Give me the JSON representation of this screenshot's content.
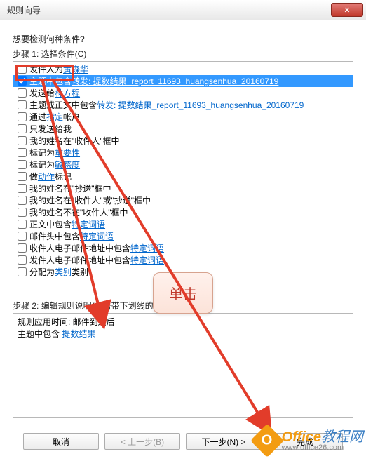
{
  "window": {
    "title": "规则向导"
  },
  "heading": "想要检测何种条件?",
  "step1_label": "步骤 1: 选择条件(C)",
  "conditions": [
    {
      "checked": false,
      "prefix": "发件人为 ",
      "link": "黄森华",
      "suffix": ""
    },
    {
      "checked": true,
      "prefix": "主题中包含 ",
      "link": "转发: 提数结果_report_11693_huangsenhua_20160719",
      "suffix": "",
      "selected": true
    },
    {
      "checked": false,
      "prefix": "发送给 ",
      "link": "林方程",
      "suffix": ""
    },
    {
      "checked": false,
      "prefix": "主题或正文中包含 ",
      "link": "转发: 提数结果_report_11693_huangsenhua_20160719",
      "suffix": ""
    },
    {
      "checked": false,
      "prefix": "通过 ",
      "link": "指定",
      "suffix": " 帐户"
    },
    {
      "checked": false,
      "prefix": "只发送给我",
      "link": "",
      "suffix": ""
    },
    {
      "checked": false,
      "prefix": "我的姓名在\"收件人\"框中",
      "link": "",
      "suffix": ""
    },
    {
      "checked": false,
      "prefix": "标记为 ",
      "link": "重要性",
      "suffix": ""
    },
    {
      "checked": false,
      "prefix": "标记为 ",
      "link": "敏感度",
      "suffix": ""
    },
    {
      "checked": false,
      "prefix": "做 ",
      "link": "动作",
      "suffix": " 标记"
    },
    {
      "checked": false,
      "prefix": "我的姓名在\"抄送\"框中",
      "link": "",
      "suffix": ""
    },
    {
      "checked": false,
      "prefix": "我的姓名在\"收件人\"或\"抄送\"框中",
      "link": "",
      "suffix": ""
    },
    {
      "checked": false,
      "prefix": "我的姓名不在\"收件人\"框中",
      "link": "",
      "suffix": ""
    },
    {
      "checked": false,
      "prefix": "正文中包含 ",
      "link": "特定词语",
      "suffix": ""
    },
    {
      "checked": false,
      "prefix": "邮件头中包含 ",
      "link": "特定词语",
      "suffix": ""
    },
    {
      "checked": false,
      "prefix": "收件人电子邮件地址中包含 ",
      "link": "特定词语",
      "suffix": ""
    },
    {
      "checked": false,
      "prefix": "发件人电子邮件地址中包含 ",
      "link": "特定词语",
      "suffix": ""
    },
    {
      "checked": false,
      "prefix": "分配为 ",
      "link": "类别",
      "suffix": " 类别"
    }
  ],
  "step2_label": "步骤 2: 编辑规则说明(单击带下划线的值)(D)",
  "desc_line1": "规则应用时间: 邮件到达后",
  "desc_line2_prefix": "主题中包含 ",
  "desc_line2_link": "提数结果",
  "callout_text": "单击",
  "buttons": {
    "cancel": "取消",
    "back": "< 上一步(B)",
    "next": "下一步(N) >",
    "finish": "完成"
  },
  "watermark": {
    "brand1": "Office",
    "brand2": "教程网",
    "url": "www.office26.com"
  }
}
